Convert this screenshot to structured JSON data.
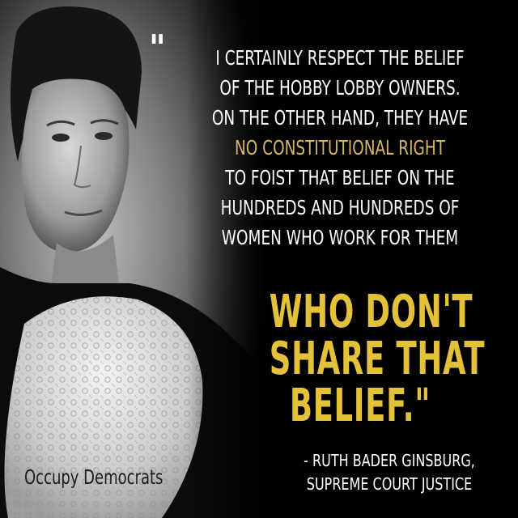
{
  "quote": {
    "open_mark": "\"",
    "lines": [
      "I CERTAINLY RESPECT THE BELIEF",
      "OF THE HOBBY LOBBY OWNERS.",
      "ON THE OTHER HAND, THEY HAVE",
      "NO CONSTITUTIONAL RIGHT",
      "TO FOIST THAT BELIEF ON THE",
      "HUNDREDS AND HUNDREDS OF",
      "WOMEN WHO WORK FOR THEM"
    ],
    "emphasis_lines": [
      "WHO DON'T",
      "SHARE THAT",
      "BELIEF.\""
    ]
  },
  "attribution": {
    "line1": "- RUTH BADER GINSBURG,",
    "line2": "SUPREME COURT JUSTICE"
  },
  "watermark": "Occupy Democrats",
  "colors": {
    "background": "#000000",
    "body_text": "#ffffff",
    "highlight_text": "#d8b56a",
    "emphasis_text": "#e3c23a"
  }
}
